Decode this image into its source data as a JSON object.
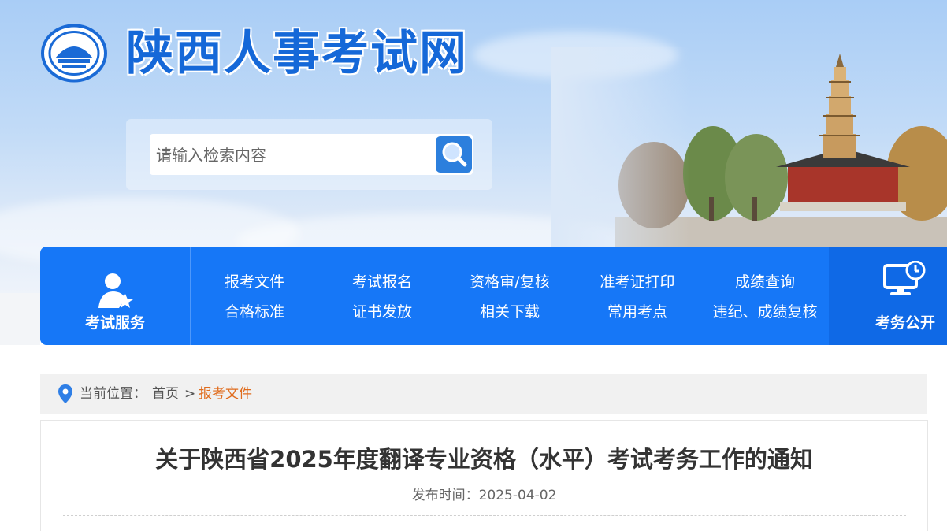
{
  "header": {
    "site_title": "陕西人事考试网",
    "search": {
      "placeholder": "请输入检索内容"
    }
  },
  "nav": {
    "service_label": "考试服务",
    "links_row1": [
      "报考文件",
      "考试报名",
      "资格审/复核",
      "准考证打印",
      "成绩查询"
    ],
    "links_row2": [
      "合格标准",
      "证书发放",
      "相关下载",
      "常用考点",
      "违纪、成绩复核"
    ],
    "public_label": "考务公开"
  },
  "breadcrumb": {
    "prefix": "当前位置：",
    "home": "首页",
    "separator": ">",
    "current": "报考文件"
  },
  "article": {
    "title": "关于陕西省2025年度翻译专业资格（水平）考试考务工作的通知",
    "date_label": "发布时间：2025-04-02"
  },
  "colors": {
    "nav_blue": "#1677f7",
    "title_blue": "#1568d8",
    "breadcrumb_active": "#e06c1d"
  },
  "icons": [
    "logo-emblem",
    "search-icon",
    "user-star-icon",
    "monitor-clock-icon",
    "location-pin-icon"
  ]
}
